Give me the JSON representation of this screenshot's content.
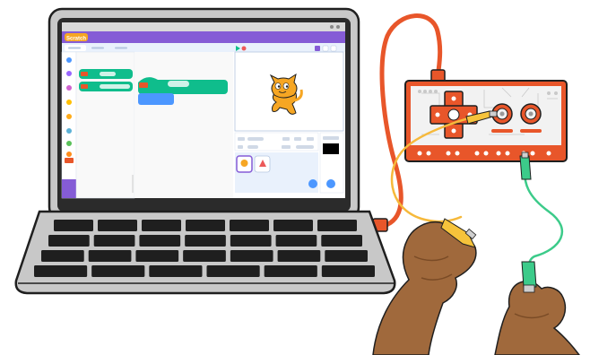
{
  "scene": {
    "description": "",
    "colors": {
      "laptop_body": "#c8c8c8",
      "laptop_outline": "#1f1f1f",
      "screen_bezel": "#2b2b2b",
      "scratch_purple": "#855cd6",
      "scratch_header": "#9966ff",
      "scratch_bg": "#e9f1fc",
      "block_green": "#0fbd8c",
      "block_blue": "#4c97ff",
      "board_orange": "#e8562a",
      "board_body": "#f2f2f2",
      "usb_cable": "#e8562a",
      "wire_yellow": "#f6b93b",
      "wire_green": "#3ccb8a",
      "clip_yellow": "#f6c33b",
      "clip_green": "#3ccb8a",
      "skin": "#a0693c",
      "skin_shadow": "#7a4b26"
    },
    "icons": [
      "scratch-cat-icon",
      "green-flag-icon",
      "stop-icon",
      "keyboard-icon",
      "makey-makey-board-icon",
      "alligator-clip-icon",
      "hand-icon"
    ],
    "app": {
      "logo_text": "Scratch"
    }
  }
}
